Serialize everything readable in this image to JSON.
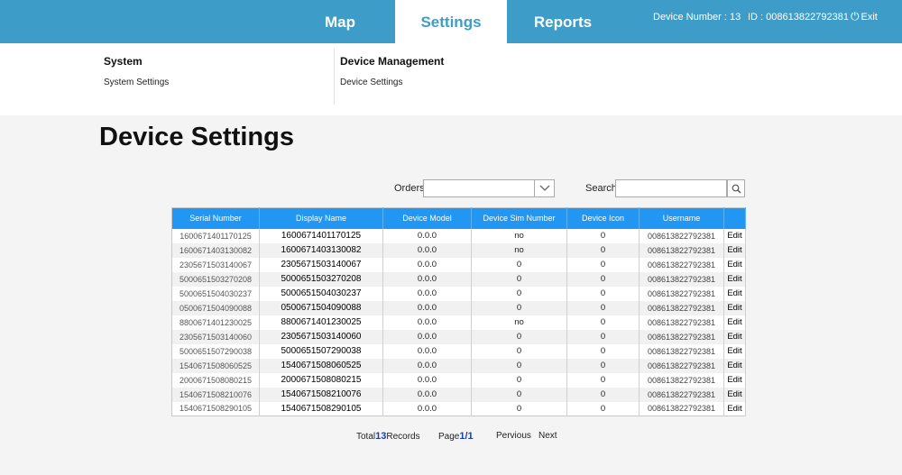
{
  "nav": {
    "tabs": [
      {
        "label": "Map",
        "active": false
      },
      {
        "label": "Settings",
        "active": true
      },
      {
        "label": "Reports",
        "active": false
      }
    ],
    "device_number_label": "Device Number : 13",
    "id_label": "ID : 008613822792381",
    "exit_label": "Exit"
  },
  "menu": {
    "groups": [
      {
        "heading": "System",
        "items": [
          "System Settings"
        ]
      },
      {
        "heading": "Device Management",
        "items": [
          "Device Settings"
        ]
      }
    ]
  },
  "page": {
    "title": "Device Settings"
  },
  "filters": {
    "orders_label": "Orders",
    "orders_value": "",
    "search_label": "Search",
    "search_value": "",
    "search_placeholder": ""
  },
  "table": {
    "columns": [
      "Serial Number",
      "Display Name",
      "Device Model",
      "Device Sim Number",
      "Device Icon",
      "Username",
      ""
    ],
    "edit_label": "Edit",
    "rows": [
      {
        "serial": "1600671401170125",
        "display": "1600671401170125",
        "model": "0.0.0",
        "sim": "no",
        "icon": "0",
        "username": "008613822792381"
      },
      {
        "serial": "1600671403130082",
        "display": "1600671403130082",
        "model": "0.0.0",
        "sim": "no",
        "icon": "0",
        "username": "008613822792381"
      },
      {
        "serial": "2305671503140067",
        "display": "2305671503140067",
        "model": "0.0.0",
        "sim": "0",
        "icon": "0",
        "username": "008613822792381"
      },
      {
        "serial": "5000651503270208",
        "display": "5000651503270208",
        "model": "0.0.0",
        "sim": "0",
        "icon": "0",
        "username": "008613822792381"
      },
      {
        "serial": "5000651504030237",
        "display": "5000651504030237",
        "model": "0.0.0",
        "sim": "0",
        "icon": "0",
        "username": "008613822792381"
      },
      {
        "serial": "0500671504090088",
        "display": "0500671504090088",
        "model": "0.0.0",
        "sim": "0",
        "icon": "0",
        "username": "008613822792381"
      },
      {
        "serial": "8800671401230025",
        "display": "8800671401230025",
        "model": "0.0.0",
        "sim": "no",
        "icon": "0",
        "username": "008613822792381"
      },
      {
        "serial": "2305671503140060",
        "display": "2305671503140060",
        "model": "0.0.0",
        "sim": "0",
        "icon": "0",
        "username": "008613822792381"
      },
      {
        "serial": "5000651507290038",
        "display": "5000651507290038",
        "model": "0.0.0",
        "sim": "0",
        "icon": "0",
        "username": "008613822792381"
      },
      {
        "serial": "1540671508060525",
        "display": "1540671508060525",
        "model": "0.0.0",
        "sim": "0",
        "icon": "0",
        "username": "008613822792381"
      },
      {
        "serial": "2000671508080215",
        "display": "2000671508080215",
        "model": "0.0.0",
        "sim": "0",
        "icon": "0",
        "username": "008613822792381"
      },
      {
        "serial": "1540671508210076",
        "display": "1540671508210076",
        "model": "0.0.0",
        "sim": "0",
        "icon": "0",
        "username": "008613822792381"
      },
      {
        "serial": "1540671508290105",
        "display": "1540671508290105",
        "model": "0.0.0",
        "sim": "0",
        "icon": "0",
        "username": "008613822792381"
      }
    ]
  },
  "pagination": {
    "total_prefix": "Total",
    "total_count": "13",
    "total_suffix": "Records",
    "page_prefix": "Page",
    "page_value": "1/1",
    "previous_label": "Pervious",
    "next_label": "Next"
  },
  "colors": {
    "header_bar": "#3d9dc8",
    "table_header": "#2196f3",
    "pager_number": "#1a3fb4"
  },
  "icons": {
    "exit": "power-icon",
    "orders": "chevron-down-icon",
    "search": "magnifier-icon"
  }
}
